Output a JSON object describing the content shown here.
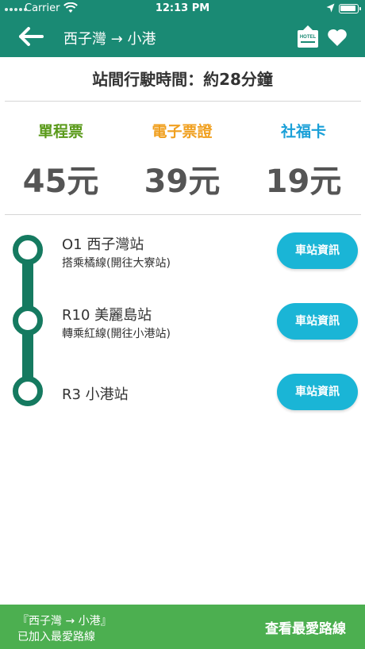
{
  "status_bar": {
    "carrier": "Carrier",
    "time": "12:13 PM"
  },
  "header": {
    "title": "西子灣 → 小港",
    "hotel_icon_text": "HOTEL",
    "background": "#1a8a74"
  },
  "travel_time": "站間行駛時間：約28分鐘",
  "fares": [
    {
      "label": "單程票",
      "price": "45元",
      "color": "#5a9a1a"
    },
    {
      "label": "電子票證",
      "price": "39元",
      "color": "#f0a020"
    },
    {
      "label": "社福卡",
      "price": "19元",
      "color": "#1aa0d8"
    }
  ],
  "stations": [
    {
      "name": "O1 西子灣站",
      "sub": "搭乘橘線(開往大寮站)",
      "button": "車站資訊"
    },
    {
      "name": "R10 美麗島站",
      "sub": "轉乘紅線(開往小港站)",
      "button": "車站資訊"
    },
    {
      "name": "R3 小港站",
      "sub": "",
      "button": "車站資訊"
    }
  ],
  "toast": {
    "line1": "『西子灣 → 小港』",
    "line2": "已加入最愛路線",
    "action": "查看最愛路線",
    "background": "#4caf50"
  },
  "colors": {
    "route_line": "#157a60",
    "info_button": "#1ab5d6"
  }
}
